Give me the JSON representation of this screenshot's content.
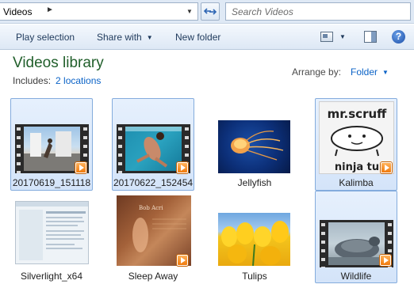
{
  "address": {
    "path": "Videos",
    "separator": "►",
    "dropdown": "▼"
  },
  "search": {
    "placeholder": "Search Videos"
  },
  "toolbar": {
    "play_selection": "Play selection",
    "share_with": "Share with",
    "new_folder": "New folder",
    "arrow": "▼"
  },
  "library": {
    "title": "Videos library",
    "includes_label": "Includes:",
    "locations_link": "2 locations",
    "arrange_by_label": "Arrange by:",
    "arrange_by_value": "Folder"
  },
  "items": [
    {
      "name": "20170619_151118",
      "type": "video",
      "selected": true
    },
    {
      "name": "20170622_152454",
      "type": "video",
      "selected": true
    },
    {
      "name": "Jellyfish",
      "type": "image",
      "selected": false
    },
    {
      "name": "Kalimba",
      "type": "music",
      "selected": true
    },
    {
      "name": "Silverlight_x64",
      "type": "app",
      "selected": false
    },
    {
      "name": "Sleep Away",
      "type": "music",
      "selected": false
    },
    {
      "name": "Tulips",
      "type": "image",
      "selected": false
    },
    {
      "name": "Wildlife",
      "type": "video",
      "selected": true
    }
  ],
  "kalimba_art": {
    "line1": "mr.scruff",
    "line2": "ninja tu"
  },
  "sleepaway_art": {
    "line1": "Bob Acri"
  },
  "colors": {
    "title_green": "#215f2b",
    "link_blue": "#0b63c7",
    "selection_border": "#84acdd",
    "badge_orange": "#f07a0c"
  }
}
